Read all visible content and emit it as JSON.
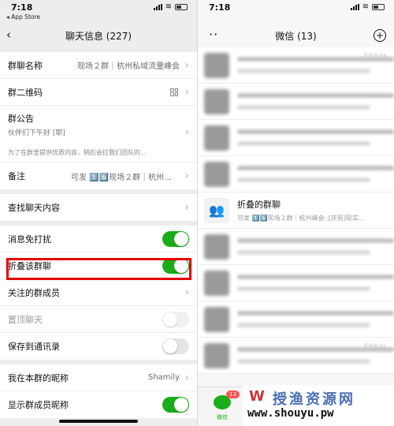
{
  "left": {
    "status": {
      "time": "7:18",
      "back_app": "◂ App Store"
    },
    "title": "聊天信息 (227)",
    "rows": {
      "group_name_label": "群聊名称",
      "group_name_value": "现场２群｜杭州私域流量峰会",
      "qr_label": "群二维码",
      "announcement_label": "群公告",
      "announcement_text": "伙伴们下午好 [耶]",
      "announcement_desc": "为了在群里提供优质内容，稍后会拉我们团队的...",
      "remark_label": "备注",
      "remark_value": "可发 1️⃣6️⃣现场２群｜杭州峰会",
      "search_history_label": "查找聊天内容",
      "mute_label": "消息免打扰",
      "fold_label": "折叠该群聊",
      "followed_members_label": "关注的群成员",
      "sticky_label": "置顶聊天",
      "save_contacts_label": "保存到通讯录",
      "my_nickname_label": "我在本群的昵称",
      "my_nickname_value": "Shamily",
      "show_nicknames_label": "显示群成员昵称"
    },
    "toggles": {
      "mute": true,
      "fold": true,
      "sticky": false,
      "save_contacts": false,
      "show_nicknames": true
    }
  },
  "right": {
    "status": {
      "time": "7:18"
    },
    "title": "微信 (13)",
    "folded_chat": {
      "name": "折叠的群聊",
      "preview": "可发 1️⃣6️⃣现场２群｜杭州峰会: [庆祝]现实..."
    },
    "times": [
      "下午7:54",
      "下午6:51"
    ],
    "tabbar": {
      "chats_label": "微信",
      "badge": "13"
    }
  },
  "watermark": {
    "text": "授渔资源网",
    "url": "www.shouyu.pw"
  },
  "colors": {
    "wechat_green": "#1aad19",
    "highlight_red": "#e60000",
    "badge_red": "#fa5151"
  }
}
